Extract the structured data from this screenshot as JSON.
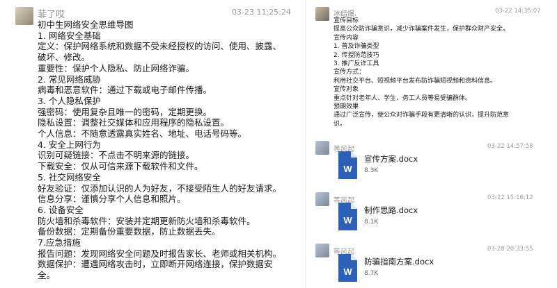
{
  "left_message": {
    "sender": "菲了哎",
    "time": "03-23 11:25:24",
    "lines": [
      "初中生网络安全思维导图",
      "1. 网络安全基础",
      "定义：保护网络系统和数据不受未经授权的访问、使用、披露、",
      "破坏、修改。",
      "重要性：保护个人隐私、防止网络诈骗。",
      "2. 常见网络威胁",
      "病毒和恶意软件：通过下载或电子邮件传播。",
      "3. 个人隐私保护",
      "强密码：使用复杂且唯一的密码，定期更换。",
      "隐私设置：调整社交媒体和应用程序的隐私设置。",
      "个人信息：不随意透露真实姓名、地址、电话号码等。",
      "4. 安全上网行为",
      "识别可疑链接：不点击不明来源的链接。",
      "下载安全：仅从可信来源下载软件和文件。",
      "5. 社交网络安全",
      "好友验证：仅添加认识的人为好友，不接受陌生人的好友请求。",
      "信息分享：谨慎分享个人信息和照片。",
      "6. 设备安全",
      "防火墙和杀毒软件：安装并定期更新防火墙和杀毒软件。",
      "备份数据：定期备份重要数据，防止数据丢失。",
      "7.应急措施",
      "报告问题：发现网络安全问题及时报告家长、老师或相关机构。",
      "数据保护：遭遇网络攻击时，立即断开网络连接，保护数据安",
      "全。"
    ]
  },
  "right_message": {
    "sender": "冰结爆.",
    "time": "03-22 14:35:07",
    "lines": [
      "宣传目标",
      "提高公众防诈骗意识，减少诈骗案件发生，保护群众财产安全。",
      "宣传内容",
      "1. 普及诈骗类型",
      "2. 传授防范技巧",
      "3. 推广反诈工具",
      "宣传方式：",
      "利用社交平台、短视频平台发布防诈骗短视频和资料信息。",
      "宣传对象",
      "重点针对老年人、学生、务工人员等易受骗群体。",
      "预期效果",
      "通过广泛宣传，使公众对诈骗手段有更清晰的认识，提升防范意",
      "识。"
    ]
  },
  "files": [
    {
      "sender": "等风起",
      "time": "03-22 14:57:58",
      "name": "宣传方案.docx",
      "size": "8.3K",
      "icon": "word-doc-icon"
    },
    {
      "sender": "等风起",
      "time": "03-22 15:16:12",
      "name": "制作思路.docx",
      "size": "8.1K",
      "icon": "word-doc-icon"
    },
    {
      "sender": "等风起",
      "time": "03-28 20:33:55",
      "name": "防骗指南方案.docx",
      "size": "8.7K",
      "icon": "word-doc-icon"
    }
  ],
  "colors": {
    "word_blue": "#2b5fb8",
    "word_light": "#dbe6f7",
    "meta_gray": "#9a9a9a"
  }
}
